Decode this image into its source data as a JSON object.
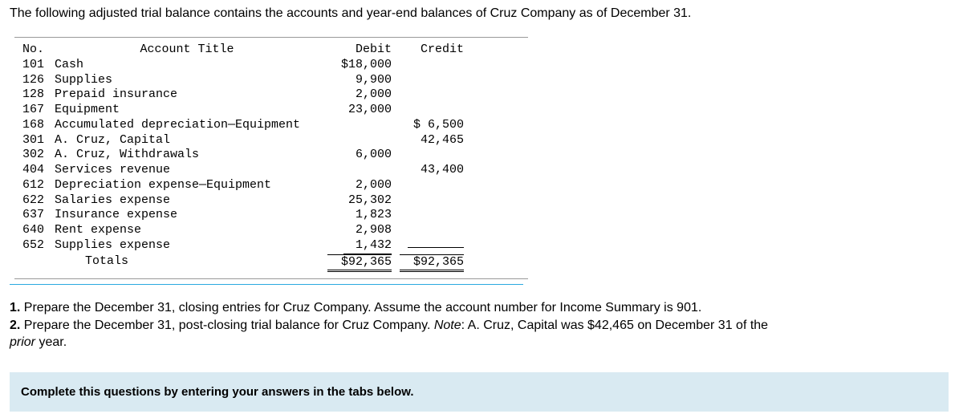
{
  "intro": "The following adjusted trial balance contains the accounts and year-end balances of Cruz Company as of December 31.",
  "headers": {
    "no": "No.",
    "title": "Account Title",
    "debit": "Debit",
    "credit": "Credit"
  },
  "rows": [
    {
      "no": "101",
      "title": "Cash",
      "debit": "$18,000",
      "credit": ""
    },
    {
      "no": "126",
      "title": "Supplies",
      "debit": "9,900",
      "credit": ""
    },
    {
      "no": "128",
      "title": "Prepaid insurance",
      "debit": "2,000",
      "credit": ""
    },
    {
      "no": "167",
      "title": "Equipment",
      "debit": "23,000",
      "credit": ""
    },
    {
      "no": "168",
      "title": "Accumulated depreciation—Equipment",
      "debit": "",
      "credit": "$ 6,500"
    },
    {
      "no": "301",
      "title": "A. Cruz, Capital",
      "debit": "",
      "credit": "42,465"
    },
    {
      "no": "302",
      "title": "A. Cruz, Withdrawals",
      "debit": "6,000",
      "credit": ""
    },
    {
      "no": "404",
      "title": "Services revenue",
      "debit": "",
      "credit": "43,400"
    },
    {
      "no": "612",
      "title": "Depreciation expense—Equipment",
      "debit": "2,000",
      "credit": ""
    },
    {
      "no": "622",
      "title": "Salaries expense",
      "debit": "25,302",
      "credit": ""
    },
    {
      "no": "637",
      "title": "Insurance expense",
      "debit": "1,823",
      "credit": ""
    },
    {
      "no": "640",
      "title": "Rent expense",
      "debit": "2,908",
      "credit": ""
    },
    {
      "no": "652",
      "title": "Supplies expense",
      "debit": "1,432",
      "credit": ""
    }
  ],
  "totals": {
    "label": "Totals",
    "debit": "$92,365",
    "credit": "$92,365"
  },
  "q1_num": "1.",
  "q1_text": " Prepare the December 31, closing entries for Cruz Company. Assume the account number for Income Summary is 901.",
  "q2_num": "2.",
  "q2_text_a": " Prepare the December 31, post-closing trial balance for Cruz Company. ",
  "q2_note_label": "Note",
  "q2_text_b": ": A. Cruz, Capital was $42,465 on December 31 of the ",
  "q2_prior": "prior",
  "q2_text_c": " year.",
  "instruction": "Complete this questions by entering your answers in the tabs below."
}
